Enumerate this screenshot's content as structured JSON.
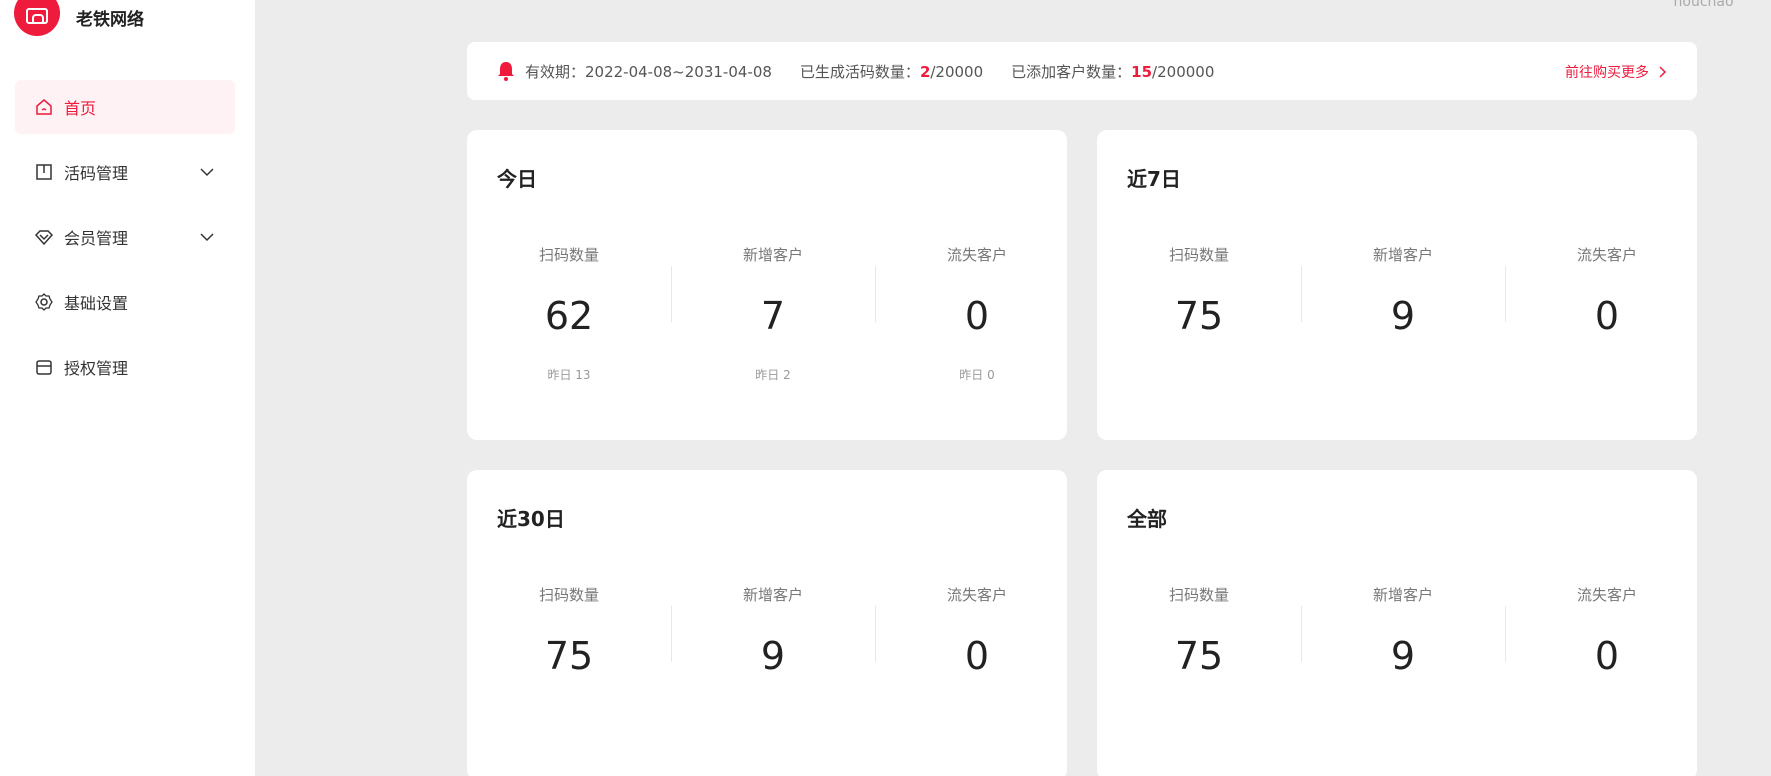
{
  "app": {
    "brand_name": "老铁网络",
    "user": "houchao ˅"
  },
  "sidebar": {
    "items": [
      {
        "label": "首页",
        "icon": "home-icon",
        "active": true
      },
      {
        "label": "活码管理",
        "icon": "book-icon",
        "expandable": true
      },
      {
        "label": "会员管理",
        "icon": "diamond-icon",
        "expandable": true
      },
      {
        "label": "基础设置",
        "icon": "gear-icon"
      },
      {
        "label": "授权管理",
        "icon": "store-icon"
      }
    ]
  },
  "notice": {
    "validity": "有效期：2022-04-08~2031-04-08",
    "codes_label": "已生成活码数量：",
    "codes_used": "2",
    "codes_total": "/20000",
    "customers_label": "已添加客户数量：",
    "customers_used": "15",
    "customers_total": "/200000",
    "buy_more": "前往购买更多"
  },
  "cards": [
    {
      "title": "今日",
      "stats": [
        {
          "label": "扫码数量",
          "value": "62",
          "sub": "昨日 13"
        },
        {
          "label": "新增客户",
          "value": "7",
          "sub": "昨日 2"
        },
        {
          "label": "流失客户",
          "value": "0",
          "sub": "昨日 0"
        }
      ]
    },
    {
      "title": "近7日",
      "stats": [
        {
          "label": "扫码数量",
          "value": "75"
        },
        {
          "label": "新增客户",
          "value": "9"
        },
        {
          "label": "流失客户",
          "value": "0"
        }
      ]
    },
    {
      "title": "近30日",
      "stats": [
        {
          "label": "扫码数量",
          "value": "75"
        },
        {
          "label": "新增客户",
          "value": "9"
        },
        {
          "label": "流失客户",
          "value": "0"
        }
      ]
    },
    {
      "title": "全部",
      "stats": [
        {
          "label": "扫码数量",
          "value": "75"
        },
        {
          "label": "新增客户",
          "value": "9"
        },
        {
          "label": "流失客户",
          "value": "0"
        }
      ]
    }
  ],
  "colors": {
    "accent": "#ee1b3d",
    "background": "#ececec",
    "card": "#ffffff"
  }
}
